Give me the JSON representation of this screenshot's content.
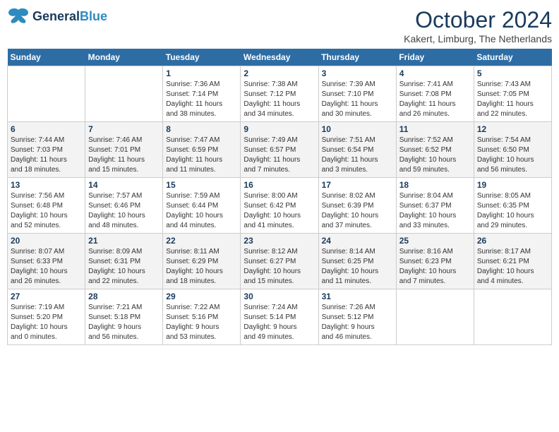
{
  "header": {
    "logo_line1": "General",
    "logo_line2": "Blue",
    "month": "October 2024",
    "location": "Kakert, Limburg, The Netherlands"
  },
  "days_of_week": [
    "Sunday",
    "Monday",
    "Tuesday",
    "Wednesday",
    "Thursday",
    "Friday",
    "Saturday"
  ],
  "weeks": [
    [
      {
        "day": "",
        "info": ""
      },
      {
        "day": "",
        "info": ""
      },
      {
        "day": "1",
        "info": "Sunrise: 7:36 AM\nSunset: 7:14 PM\nDaylight: 11 hours\nand 38 minutes."
      },
      {
        "day": "2",
        "info": "Sunrise: 7:38 AM\nSunset: 7:12 PM\nDaylight: 11 hours\nand 34 minutes."
      },
      {
        "day": "3",
        "info": "Sunrise: 7:39 AM\nSunset: 7:10 PM\nDaylight: 11 hours\nand 30 minutes."
      },
      {
        "day": "4",
        "info": "Sunrise: 7:41 AM\nSunset: 7:08 PM\nDaylight: 11 hours\nand 26 minutes."
      },
      {
        "day": "5",
        "info": "Sunrise: 7:43 AM\nSunset: 7:05 PM\nDaylight: 11 hours\nand 22 minutes."
      }
    ],
    [
      {
        "day": "6",
        "info": "Sunrise: 7:44 AM\nSunset: 7:03 PM\nDaylight: 11 hours\nand 18 minutes."
      },
      {
        "day": "7",
        "info": "Sunrise: 7:46 AM\nSunset: 7:01 PM\nDaylight: 11 hours\nand 15 minutes."
      },
      {
        "day": "8",
        "info": "Sunrise: 7:47 AM\nSunset: 6:59 PM\nDaylight: 11 hours\nand 11 minutes."
      },
      {
        "day": "9",
        "info": "Sunrise: 7:49 AM\nSunset: 6:57 PM\nDaylight: 11 hours\nand 7 minutes."
      },
      {
        "day": "10",
        "info": "Sunrise: 7:51 AM\nSunset: 6:54 PM\nDaylight: 11 hours\nand 3 minutes."
      },
      {
        "day": "11",
        "info": "Sunrise: 7:52 AM\nSunset: 6:52 PM\nDaylight: 10 hours\nand 59 minutes."
      },
      {
        "day": "12",
        "info": "Sunrise: 7:54 AM\nSunset: 6:50 PM\nDaylight: 10 hours\nand 56 minutes."
      }
    ],
    [
      {
        "day": "13",
        "info": "Sunrise: 7:56 AM\nSunset: 6:48 PM\nDaylight: 10 hours\nand 52 minutes."
      },
      {
        "day": "14",
        "info": "Sunrise: 7:57 AM\nSunset: 6:46 PM\nDaylight: 10 hours\nand 48 minutes."
      },
      {
        "day": "15",
        "info": "Sunrise: 7:59 AM\nSunset: 6:44 PM\nDaylight: 10 hours\nand 44 minutes."
      },
      {
        "day": "16",
        "info": "Sunrise: 8:00 AM\nSunset: 6:42 PM\nDaylight: 10 hours\nand 41 minutes."
      },
      {
        "day": "17",
        "info": "Sunrise: 8:02 AM\nSunset: 6:39 PM\nDaylight: 10 hours\nand 37 minutes."
      },
      {
        "day": "18",
        "info": "Sunrise: 8:04 AM\nSunset: 6:37 PM\nDaylight: 10 hours\nand 33 minutes."
      },
      {
        "day": "19",
        "info": "Sunrise: 8:05 AM\nSunset: 6:35 PM\nDaylight: 10 hours\nand 29 minutes."
      }
    ],
    [
      {
        "day": "20",
        "info": "Sunrise: 8:07 AM\nSunset: 6:33 PM\nDaylight: 10 hours\nand 26 minutes."
      },
      {
        "day": "21",
        "info": "Sunrise: 8:09 AM\nSunset: 6:31 PM\nDaylight: 10 hours\nand 22 minutes."
      },
      {
        "day": "22",
        "info": "Sunrise: 8:11 AM\nSunset: 6:29 PM\nDaylight: 10 hours\nand 18 minutes."
      },
      {
        "day": "23",
        "info": "Sunrise: 8:12 AM\nSunset: 6:27 PM\nDaylight: 10 hours\nand 15 minutes."
      },
      {
        "day": "24",
        "info": "Sunrise: 8:14 AM\nSunset: 6:25 PM\nDaylight: 10 hours\nand 11 minutes."
      },
      {
        "day": "25",
        "info": "Sunrise: 8:16 AM\nSunset: 6:23 PM\nDaylight: 10 hours\nand 7 minutes."
      },
      {
        "day": "26",
        "info": "Sunrise: 8:17 AM\nSunset: 6:21 PM\nDaylight: 10 hours\nand 4 minutes."
      }
    ],
    [
      {
        "day": "27",
        "info": "Sunrise: 7:19 AM\nSunset: 5:20 PM\nDaylight: 10 hours\nand 0 minutes."
      },
      {
        "day": "28",
        "info": "Sunrise: 7:21 AM\nSunset: 5:18 PM\nDaylight: 9 hours\nand 56 minutes."
      },
      {
        "day": "29",
        "info": "Sunrise: 7:22 AM\nSunset: 5:16 PM\nDaylight: 9 hours\nand 53 minutes."
      },
      {
        "day": "30",
        "info": "Sunrise: 7:24 AM\nSunset: 5:14 PM\nDaylight: 9 hours\nand 49 minutes."
      },
      {
        "day": "31",
        "info": "Sunrise: 7:26 AM\nSunset: 5:12 PM\nDaylight: 9 hours\nand 46 minutes."
      },
      {
        "day": "",
        "info": ""
      },
      {
        "day": "",
        "info": ""
      }
    ]
  ]
}
